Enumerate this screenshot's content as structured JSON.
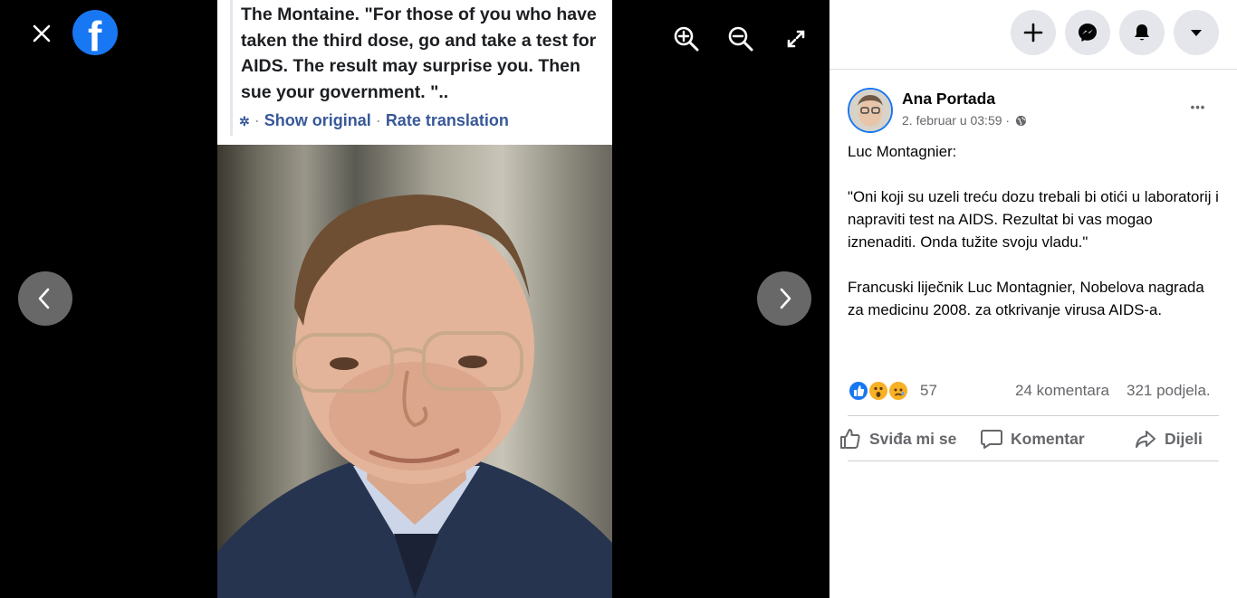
{
  "viewer": {
    "close_icon": "close-icon",
    "logo": "f",
    "zoom_in_icon": "zoom-in-icon",
    "zoom_out_icon": "zoom-out-icon",
    "fullscreen_icon": "fullscreen-icon",
    "prev_icon": "chevron-left-icon",
    "next_icon": "chevron-right-icon",
    "caption_text": "The Montaine. \"For those of you who have taken the third dose, go and take a test for AIDS. The result may surprise you. Then sue your government. \"..",
    "show_original": "Show original",
    "rate_translation": "Rate translation",
    "dot": "·"
  },
  "topbar": {
    "create_icon": "plus-icon",
    "messenger_icon": "messenger-icon",
    "notifications_icon": "bell-icon",
    "account_icon": "caret-down-icon"
  },
  "post": {
    "author": "Ana Portada",
    "date": "2. februar u 03:59 ·",
    "privacy_icon": "globe-icon",
    "more_label": "•••",
    "body": {
      "line1": "Luc Montagnier:",
      "line2": "\"Oni koji su uzeli treću dozu trebali bi otići u laboratorij i napraviti test na AIDS. Rezultat bi vas mogao iznenaditi. Onda tužite svoju vladu.\"",
      "line3": "Francuski liječnik Luc Montagnier, Nobelova nagrada za medicinu 2008. za otkrivanje virusa AIDS-a."
    },
    "reaction_count": "57",
    "comments": "24 komentara",
    "shares": "321 podjela.",
    "actions": {
      "like": "Sviđa mi se",
      "comment": "Komentar",
      "share": "Dijeli"
    }
  },
  "colors": {
    "brand": "#1877f2",
    "link": "#385898",
    "muted": "#65676b"
  }
}
